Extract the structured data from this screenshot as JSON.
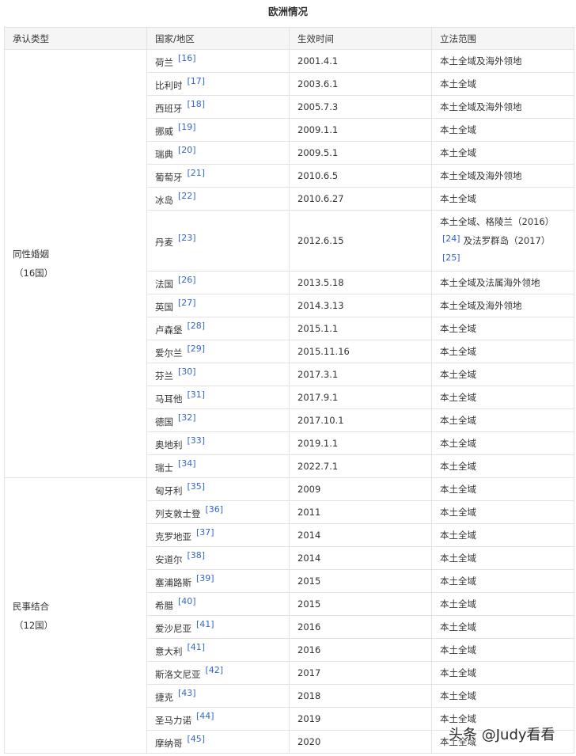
{
  "caption": "欧洲情况",
  "headers": [
    "承认类型",
    "国家/地区",
    "生效时间",
    "立法范围"
  ],
  "groups": [
    {
      "label": "同性婚姻",
      "count": "（16国）",
      "rows": [
        {
          "country": "荷兰",
          "ref": "[16]",
          "date": "2001.4.1",
          "scope": "本土全域及海外领地"
        },
        {
          "country": "比利时",
          "ref": "[17]",
          "date": "2003.6.1",
          "scope": "本土全域"
        },
        {
          "country": "西班牙",
          "ref": "[18]",
          "date": "2005.7.3",
          "scope": "本土全域及海外领地"
        },
        {
          "country": "挪威",
          "ref": "[19]",
          "date": "2009.1.1",
          "scope": "本土全域"
        },
        {
          "country": "瑞典",
          "ref": "[20]",
          "date": "2009.5.1",
          "scope": "本土全域"
        },
        {
          "country": "葡萄牙",
          "ref": "[21]",
          "date": "2010.6.5",
          "scope": "本土全域及海外领地"
        },
        {
          "country": "冰岛",
          "ref": "[22]",
          "date": "2010.6.27",
          "scope": "本土全域"
        },
        {
          "country": "丹麦",
          "ref": "[23]",
          "date": "2012.6.15",
          "scope": "",
          "scope_parts": [
            "本土全域、格陵兰（2016）",
            "[24]",
            "及法罗群岛（2017）",
            "[25]"
          ]
        },
        {
          "country": "法国",
          "ref": "[26]",
          "date": "2013.5.18",
          "scope": "本土全域及法属海外领地"
        },
        {
          "country": "英国",
          "ref": "[27]",
          "date": "2014.3.13",
          "scope": "本土全域及海外领地"
        },
        {
          "country": "卢森堡",
          "ref": "[28]",
          "date": "2015.1.1",
          "scope": "本土全域"
        },
        {
          "country": "爱尔兰",
          "ref": "[29]",
          "date": "2015.11.16",
          "scope": "本土全域"
        },
        {
          "country": "芬兰",
          "ref": "[30]",
          "date": "2017.3.1",
          "scope": "本土全域"
        },
        {
          "country": "马耳他",
          "ref": "[31]",
          "date": "2017.9.1",
          "scope": "本土全域"
        },
        {
          "country": "德国",
          "ref": "[32]",
          "date": "2017.10.1",
          "scope": "本土全域"
        },
        {
          "country": "奥地利",
          "ref": "[33]",
          "date": "2019.1.1",
          "scope": "本土全域"
        },
        {
          "country": "瑞士",
          "ref": "[34]",
          "date": "2022.7.1",
          "scope": "本土全域"
        }
      ]
    },
    {
      "label": "民事结合",
      "count": "（12国）",
      "rows": [
        {
          "country": "匈牙利",
          "ref": "[35]",
          "date": "2009",
          "scope": "本土全域"
        },
        {
          "country": "列支敦士登",
          "ref": "[36]",
          "date": "2011",
          "scope": "本土全域"
        },
        {
          "country": "克罗地亚",
          "ref": "[37]",
          "date": "2014",
          "scope": "本土全域"
        },
        {
          "country": "安道尔",
          "ref": "[38]",
          "date": "2014",
          "scope": "本土全域"
        },
        {
          "country": "塞浦路斯",
          "ref": "[39]",
          "date": "2015",
          "scope": "本土全域"
        },
        {
          "country": "希腊",
          "ref": "[40]",
          "date": "2015",
          "scope": "本土全域"
        },
        {
          "country": "爱沙尼亚",
          "ref": "[41]",
          "date": "2016",
          "scope": "本土全域"
        },
        {
          "country": "意大利",
          "ref": "[41]",
          "date": "2016",
          "scope": "本土全域"
        },
        {
          "country": "斯洛文尼亚",
          "ref": "[42]",
          "date": "2017",
          "scope": "本土全域"
        },
        {
          "country": "捷克",
          "ref": "[43]",
          "date": "2018",
          "scope": "本土全域"
        },
        {
          "country": "圣马力诺",
          "ref": "[44]",
          "date": "2019",
          "scope": "本土全域"
        },
        {
          "country": "摩纳哥",
          "ref": "[45]",
          "date": "2020",
          "scope": "本土全域"
        }
      ]
    }
  ],
  "watermark": "头条 @Judy看看",
  "colors": {
    "link": "#3366cc",
    "border": "#e2e2e2",
    "header_bg": "#f5f5f5",
    "text": "#333333"
  }
}
